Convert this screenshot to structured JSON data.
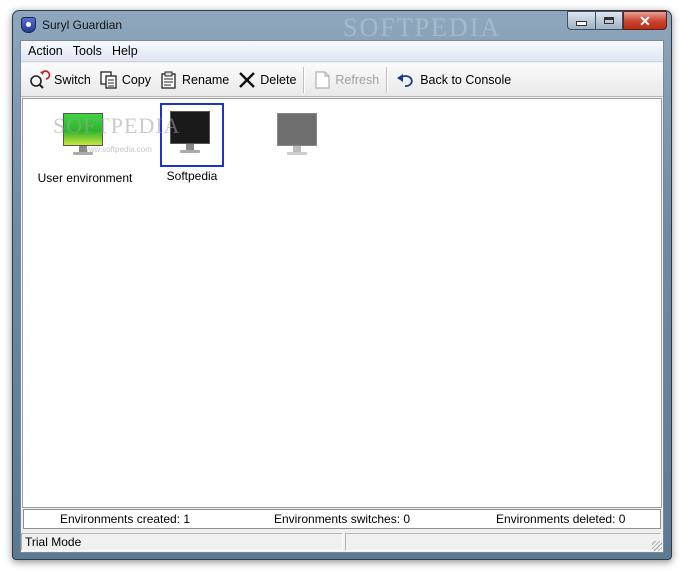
{
  "window": {
    "title": "Suryl Guardian",
    "watermark": "SOFTPEDIA"
  },
  "menu": [
    "Action",
    "Tools",
    "Help"
  ],
  "toolbar": {
    "switch": "Switch",
    "copy": "Copy",
    "rename": "Rename",
    "delete": "Delete",
    "refresh": "Refresh",
    "back": "Back to Console"
  },
  "environments": [
    {
      "label": "User environment",
      "icon": "green-screen-monitor-icon",
      "selected": false
    },
    {
      "label": "Softpedia",
      "icon": "black-screen-monitor-icon",
      "selected": true
    },
    {
      "label": "",
      "icon": "gray-screen-monitor-icon",
      "selected": false
    }
  ],
  "watermark": {
    "big": "SOFTPEDIA",
    "small": "www.softpedia.com"
  },
  "stats": {
    "created": "Environments created: 1",
    "switches": "Environments switches: 0",
    "deleted": "Environments deleted: 0"
  },
  "status": {
    "mode": "Trial Mode"
  },
  "colors": {
    "selection": "#1a35c8",
    "close_button": "#c9432d"
  }
}
